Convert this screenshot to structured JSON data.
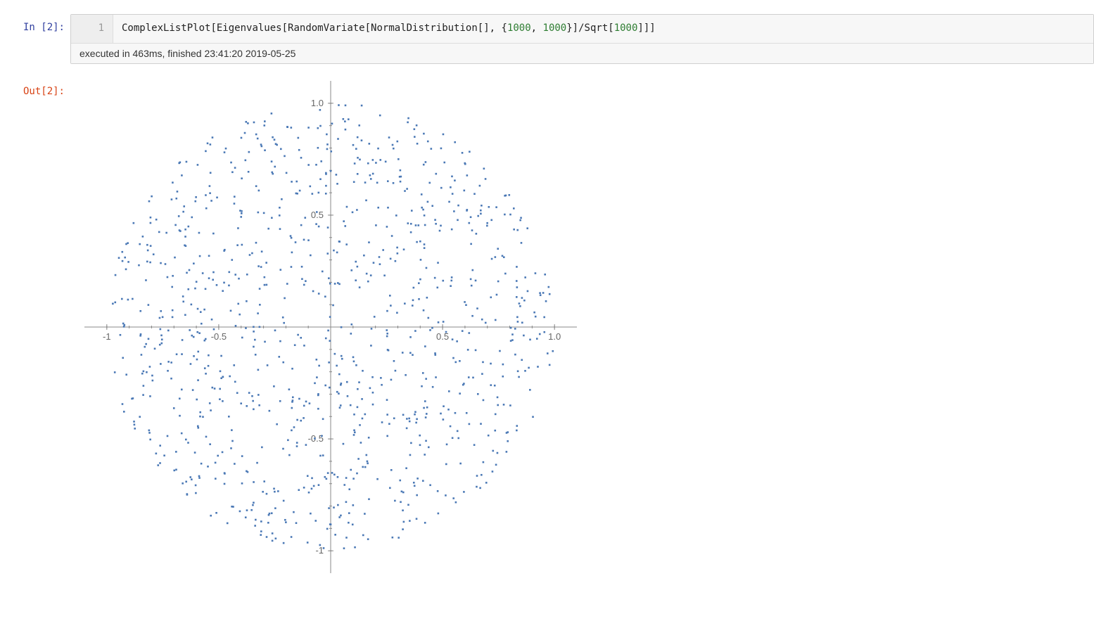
{
  "cell": {
    "in_prompt": "In [2]:",
    "out_prompt": "Out[2]:",
    "line_number": "1",
    "exec_info": "executed in 463ms, finished 23:41:20 2019-05-25",
    "code_tokens": [
      {
        "t": "ComplexListPlot",
        "c": "tok-fn"
      },
      {
        "t": "[",
        "c": "tok-br"
      },
      {
        "t": "Eigenvalues",
        "c": "tok-fn"
      },
      {
        "t": "[",
        "c": "tok-br"
      },
      {
        "t": "RandomVariate",
        "c": "tok-fn"
      },
      {
        "t": "[",
        "c": "tok-br"
      },
      {
        "t": "NormalDistribution",
        "c": "tok-fn"
      },
      {
        "t": "[",
        "c": "tok-br"
      },
      {
        "t": "]",
        "c": "tok-br"
      },
      {
        "t": ", ",
        "c": "tok-punct"
      },
      {
        "t": "{",
        "c": "tok-br"
      },
      {
        "t": "1000",
        "c": "tok-num"
      },
      {
        "t": ", ",
        "c": "tok-punct"
      },
      {
        "t": "1000",
        "c": "tok-num"
      },
      {
        "t": "}",
        "c": "tok-br"
      },
      {
        "t": "]",
        "c": "tok-br"
      },
      {
        "t": "/",
        "c": "tok-punct"
      },
      {
        "t": "Sqrt",
        "c": "tok-fn"
      },
      {
        "t": "[",
        "c": "tok-br"
      },
      {
        "t": "1000",
        "c": "tok-num"
      },
      {
        "t": "]",
        "c": "tok-br"
      },
      {
        "t": "]",
        "c": "tok-br"
      },
      {
        "t": "]",
        "c": "tok-br"
      }
    ]
  },
  "chart_data": {
    "type": "scatter",
    "title": "",
    "xlabel": "",
    "ylabel": "",
    "xlim": [
      -1.1,
      1.1
    ],
    "ylim": [
      -1.1,
      1.1
    ],
    "xticks": [
      -1.0,
      -0.5,
      0.5,
      1.0
    ],
    "yticks": [
      -1.0,
      -0.5,
      0.5,
      1.0
    ],
    "description": "Scatter of ~1000 complex eigenvalues of a 1000×1000 normalized Gaussian random matrix, approximately uniformly filling the unit disk (circular law).",
    "n_points": 1000,
    "disk_radius": 1.0,
    "point_color": "#4a78b5"
  }
}
